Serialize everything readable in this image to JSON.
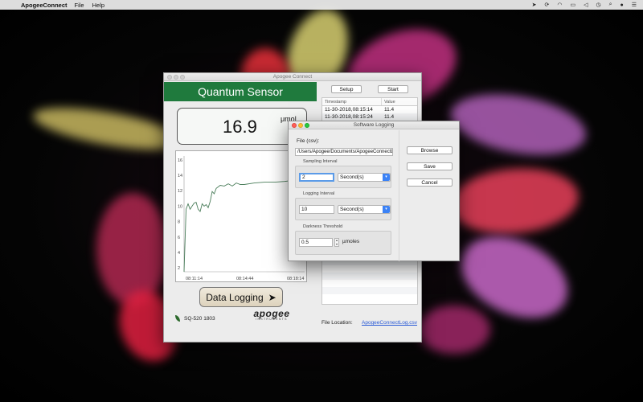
{
  "menubar": {
    "app_name": "ApogeeConnect",
    "items": [
      "File",
      "Help"
    ]
  },
  "main_window": {
    "title": "Apogee Connect",
    "sensor_title": "Quantum Sensor",
    "reading_value": "16.9",
    "reading_unit_line1": "μmol",
    "reading_unit_line2": "m",
    "setup_label": "Setup",
    "start_label": "Start",
    "table": {
      "columns": [
        "Timestamp",
        "Value"
      ],
      "rows": [
        {
          "timestamp": "11-30-2018,08:15:14",
          "value": "11.4"
        },
        {
          "timestamp": "11-30-2018,08:15:24",
          "value": "11.4"
        }
      ]
    },
    "data_logging_label": "Data Logging",
    "device_model": "SQ-520 1803",
    "brand_name": "apogee",
    "brand_sub": "INSTRUMENTS",
    "file_location_label": "File Location:",
    "file_location_link": "ApogeeConnectLog.csv"
  },
  "chart_data": {
    "type": "line",
    "x_ticks": [
      "08:11:14",
      "08:14:44",
      "08:18:14"
    ],
    "y_ticks": [
      2,
      4,
      6,
      8,
      10,
      12,
      14,
      16
    ],
    "ylim": [
      1.5,
      16.5
    ],
    "series": [
      {
        "values": [
          [
            0,
            1.5
          ],
          [
            2,
            9.6
          ],
          [
            4,
            10.3
          ],
          [
            6,
            9.6
          ],
          [
            8,
            10.0
          ],
          [
            10,
            10.4
          ],
          [
            12,
            10.5
          ],
          [
            14,
            9.6
          ],
          [
            16,
            9.3
          ],
          [
            18,
            10.3
          ],
          [
            20,
            10.0
          ],
          [
            22,
            10.2
          ],
          [
            24,
            9.8
          ],
          [
            26,
            10.6
          ],
          [
            28,
            11.9
          ],
          [
            30,
            11.6
          ],
          [
            32,
            12.3
          ],
          [
            36,
            12.7
          ],
          [
            40,
            12.6
          ],
          [
            44,
            12.9
          ],
          [
            48,
            12.6
          ],
          [
            52,
            13.0
          ],
          [
            56,
            12.8
          ],
          [
            60,
            12.8
          ],
          [
            70,
            13.0
          ],
          [
            80,
            13.1
          ],
          [
            90,
            13.1
          ],
          [
            100,
            13.2
          ],
          [
            106,
            13.3
          ],
          [
            110,
            14.1
          ],
          [
            114,
            14.4
          ],
          [
            120,
            14.3
          ]
        ]
      }
    ],
    "color": "#4a7d5a"
  },
  "dialog": {
    "title": "Software Logging",
    "file_label": "File (csv):",
    "file_path": "/Users/Apogee/Documents/ApogeeConnectLog.csv",
    "sampling_label": "Sampling Interval",
    "sampling_value": "2",
    "sampling_unit": "Second(s)",
    "logging_label": "Logging Interval",
    "logging_value": "10",
    "logging_unit": "Second(s)",
    "darkness_label": "Darkness Threshold",
    "darkness_value": "0.5",
    "darkness_unit": "µmoles",
    "browse_label": "Browse",
    "save_label": "Save",
    "cancel_label": "Cancel"
  }
}
